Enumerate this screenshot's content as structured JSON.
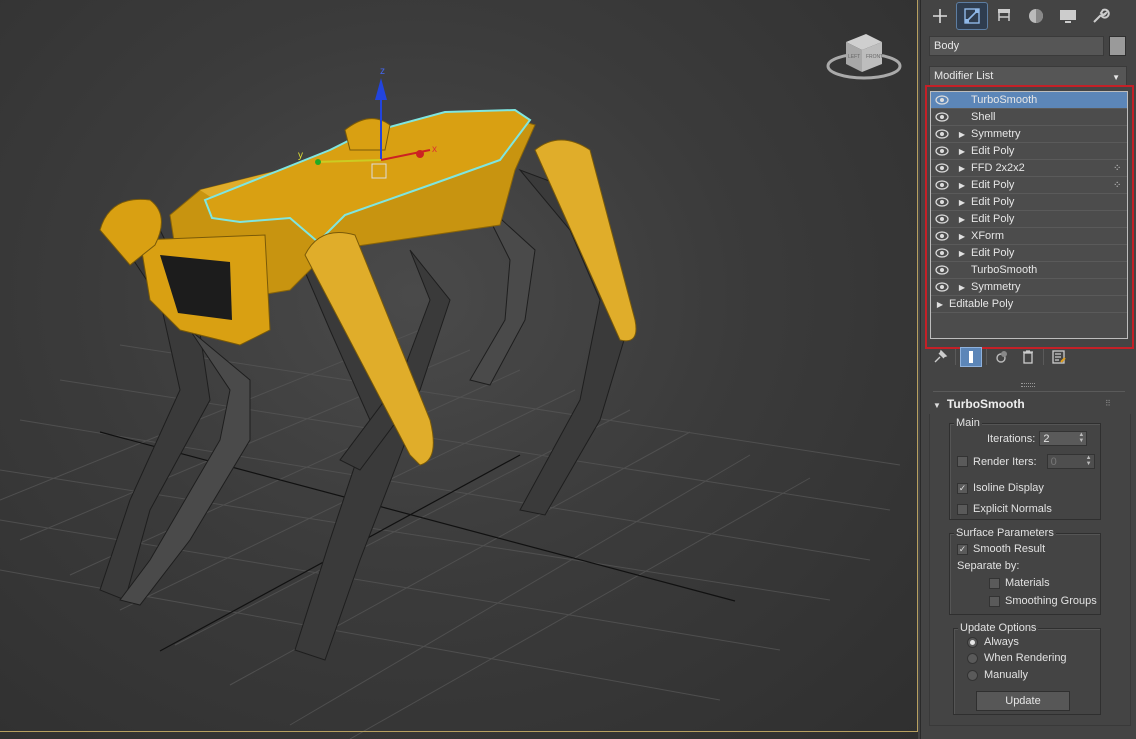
{
  "command_tabs": [
    {
      "name": "create-tab",
      "icon": "plus-icon"
    },
    {
      "name": "modify-tab",
      "icon": "modify-icon",
      "active": true
    },
    {
      "name": "hierarchy-tab",
      "icon": "hierarchy-icon"
    },
    {
      "name": "motion-tab",
      "icon": "motion-icon"
    },
    {
      "name": "display-tab",
      "icon": "display-icon"
    },
    {
      "name": "utilities-tab",
      "icon": "wrench-icon"
    }
  ],
  "object_name": "Body",
  "modifier_list_label": "Modifier List",
  "stack": [
    {
      "label": "TurboSmooth",
      "expand": false,
      "selected": true,
      "gizmo": false
    },
    {
      "label": "Shell",
      "expand": false,
      "selected": false,
      "gizmo": false
    },
    {
      "label": "Symmetry",
      "expand": true,
      "selected": false,
      "gizmo": false
    },
    {
      "label": "Edit Poly",
      "expand": true,
      "selected": false,
      "gizmo": false
    },
    {
      "label": "FFD 2x2x2",
      "expand": true,
      "selected": false,
      "gizmo": true
    },
    {
      "label": "Edit Poly",
      "expand": true,
      "selected": false,
      "gizmo": true
    },
    {
      "label": "Edit Poly",
      "expand": true,
      "selected": false,
      "gizmo": false
    },
    {
      "label": "Edit Poly",
      "expand": true,
      "selected": false,
      "gizmo": false
    },
    {
      "label": "XForm",
      "expand": true,
      "selected": false,
      "gizmo": false
    },
    {
      "label": "Edit Poly",
      "expand": true,
      "selected": false,
      "gizmo": false
    },
    {
      "label": "TurboSmooth",
      "expand": false,
      "selected": false,
      "gizmo": false
    },
    {
      "label": "Symmetry",
      "expand": true,
      "selected": false,
      "gizmo": false
    }
  ],
  "base_object": "Editable Poly",
  "rollout": {
    "title": "TurboSmooth",
    "main": {
      "title": "Main",
      "iterations_label": "Iterations:",
      "iterations_value": "2",
      "render_iters_label": "Render Iters:",
      "render_iters_value": "0",
      "render_iters_checked": false,
      "isoline_label": "Isoline Display",
      "isoline_checked": true,
      "explicit_normals_label": "Explicit Normals",
      "explicit_normals_checked": false
    },
    "surface": {
      "title": "Surface Parameters",
      "smooth_result_label": "Smooth Result",
      "smooth_result_checked": true,
      "separate_by_label": "Separate by:",
      "materials_label": "Materials",
      "materials_checked": false,
      "smoothing_groups_label": "Smoothing Groups",
      "smoothing_groups_checked": false
    },
    "update": {
      "title": "Update Options",
      "always_label": "Always",
      "when_rendering_label": "When Rendering",
      "manually_label": "Manually",
      "selected": "always",
      "update_button": "Update"
    }
  },
  "viewport": {
    "gizmo_axes": {
      "x": "x",
      "y": "y",
      "z": "z"
    },
    "viewcube_labels": {
      "left": "LEFT",
      "front": "FRONT"
    }
  },
  "colors": {
    "accent_blue": "#5c86b8",
    "highlight_red": "#c42027",
    "robot_yellow": "#d9a012",
    "selection_cyan": "#7fe6e0"
  }
}
